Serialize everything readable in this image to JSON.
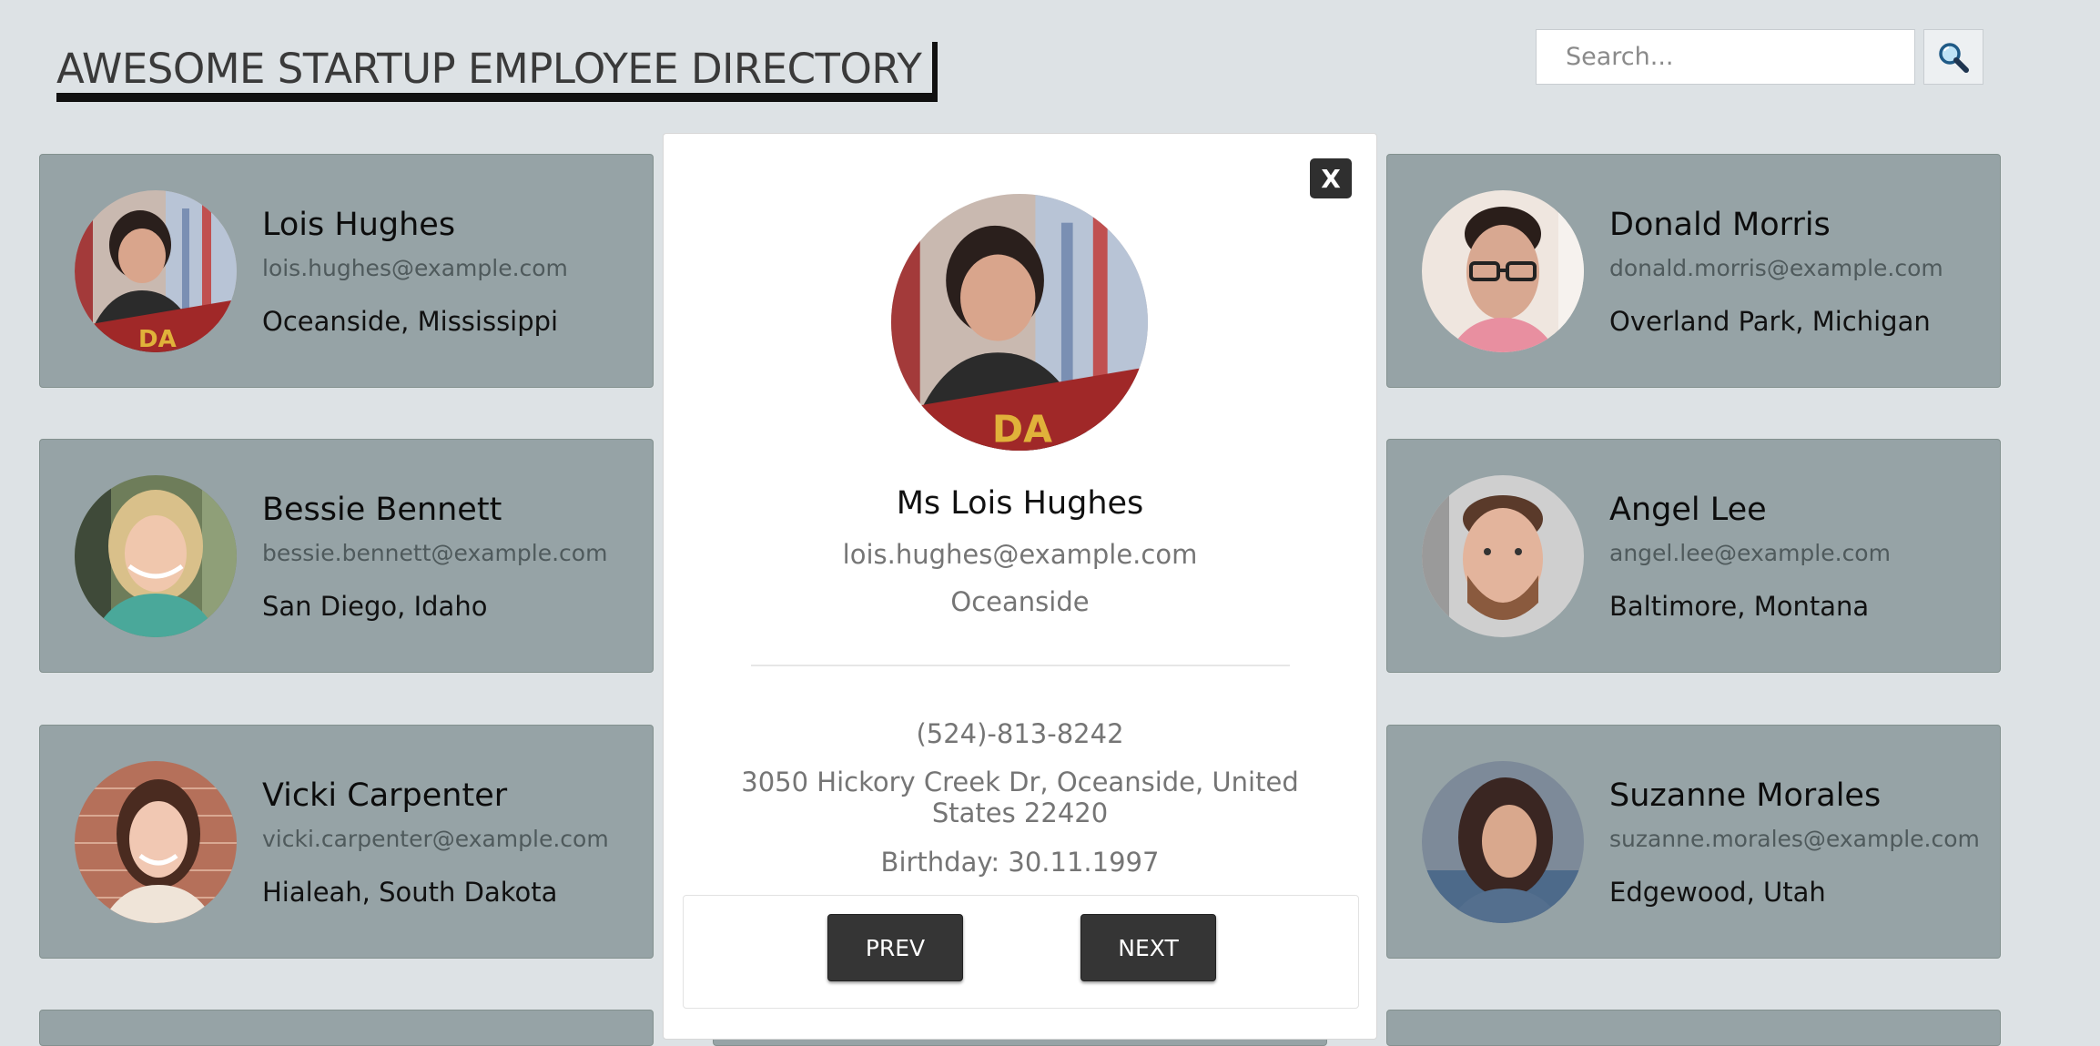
{
  "header": {
    "title": "AWESOME STARTUP EMPLOYEE DIRECTORY"
  },
  "search": {
    "placeholder": "Search...",
    "button_icon": "magnifier-icon"
  },
  "employees": [
    {
      "name": "Lois Hughes",
      "email": "lois.hughes@example.com",
      "location": "Oceanside, Mississippi"
    },
    {
      "name": "Donald Morris",
      "email": "donald.morris@example.com",
      "location": "Overland Park, Michigan"
    },
    {
      "name": "Bessie Bennett",
      "email": "bessie.bennett@example.com",
      "location": "San Diego, Idaho"
    },
    {
      "name": "Angel Lee",
      "email": "angel.lee@example.com",
      "location": "Baltimore, Montana"
    },
    {
      "name": "Vicki Carpenter",
      "email": "vicki.carpenter@example.com",
      "location": "Hialeah, South Dakota"
    },
    {
      "name": "Suzanne Morales",
      "email": "suzanne.morales@example.com",
      "location": "Edgewood, Utah"
    }
  ],
  "modal": {
    "close_label": "X",
    "name": "Ms Lois Hughes",
    "email": "lois.hughes@example.com",
    "city": "Oceanside",
    "phone": "(524)-813-8242",
    "address": "3050 Hickory Creek Dr, Oceanside, United States 22420",
    "birthday": "Birthday: 30.11.1997",
    "prev_label": "PREV",
    "next_label": "NEXT"
  },
  "colors": {
    "page_background": "#dde2e5",
    "card_background": "#96a3a6",
    "button_dark": "#353535"
  }
}
